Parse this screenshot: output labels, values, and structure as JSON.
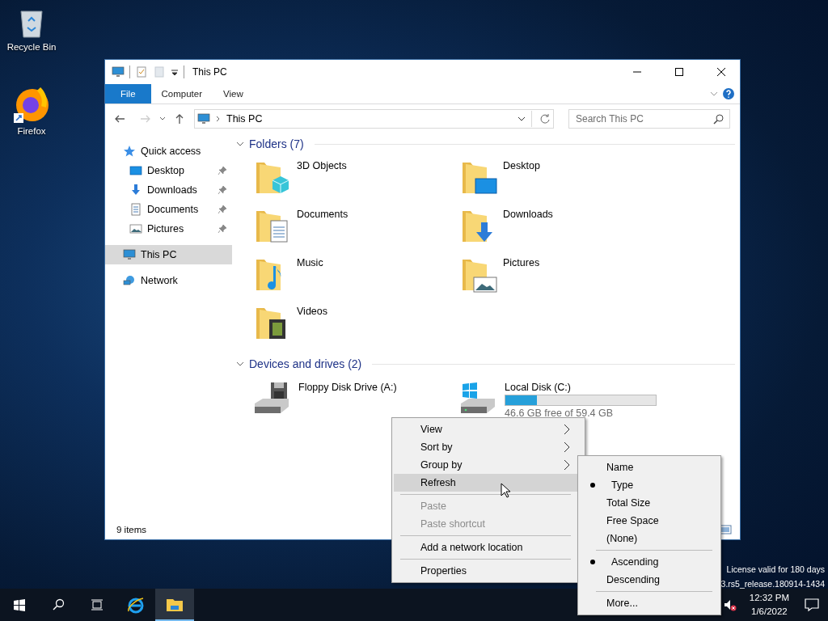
{
  "desktop_icons": [
    {
      "label": "Recycle Bin",
      "kind": "recycle"
    },
    {
      "label": "Firefox",
      "kind": "firefox"
    }
  ],
  "window": {
    "title": "This PC",
    "ribbon_tabs": [
      {
        "label": "File",
        "selected": true
      },
      {
        "label": "Computer",
        "selected": false
      },
      {
        "label": "View",
        "selected": false
      }
    ],
    "address": "This PC",
    "search": {
      "placeholder": "Search This PC"
    },
    "nav": [
      {
        "label": "Quick access",
        "kind": "star",
        "selected": false,
        "children": [
          {
            "label": "Desktop",
            "kind": "desktop",
            "pinned": true
          },
          {
            "label": "Downloads",
            "kind": "downloads",
            "pinned": true
          },
          {
            "label": "Documents",
            "kind": "documents",
            "pinned": true
          },
          {
            "label": "Pictures",
            "kind": "pictures",
            "pinned": true
          }
        ]
      },
      {
        "label": "This PC",
        "kind": "pc",
        "selected": true
      },
      {
        "label": "Network",
        "kind": "network",
        "selected": false
      }
    ],
    "folders": {
      "title": "Folders (7)",
      "expanded": true,
      "items": [
        {
          "name": "3D Objects",
          "kind": "objects"
        },
        {
          "name": "Desktop",
          "kind": "desktop"
        },
        {
          "name": "Documents",
          "kind": "documents"
        },
        {
          "name": "Downloads",
          "kind": "downloads"
        },
        {
          "name": "Music",
          "kind": "music"
        },
        {
          "name": "Pictures",
          "kind": "pictures"
        },
        {
          "name": "Videos",
          "kind": "videos"
        }
      ]
    },
    "drives": {
      "title": "Devices and drives (2)",
      "expanded": true,
      "items": [
        {
          "name": "Floppy Disk Drive (A:)",
          "kind": "floppy"
        },
        {
          "name": "Local Disk (C:)",
          "kind": "disk",
          "level": 0.21,
          "free": "46.6 GB free of 59.4 GB"
        }
      ]
    },
    "status_bar": "9 items"
  },
  "context_menu": {
    "items": [
      {
        "kind": "item",
        "label": "View",
        "submenu": true,
        "disabled": false,
        "selected": false
      },
      {
        "kind": "item",
        "label": "Sort by",
        "submenu": true,
        "disabled": false,
        "selected": false
      },
      {
        "kind": "item",
        "label": "Group by",
        "submenu": true,
        "disabled": false,
        "selected": false
      },
      {
        "kind": "item",
        "label": "Refresh",
        "submenu": false,
        "disabled": false,
        "selected": true
      },
      {
        "kind": "separator"
      },
      {
        "kind": "item",
        "label": "Paste",
        "submenu": false,
        "disabled": true,
        "selected": false
      },
      {
        "kind": "item",
        "label": "Paste shortcut",
        "submenu": false,
        "disabled": true,
        "selected": false
      },
      {
        "kind": "separator"
      },
      {
        "kind": "item",
        "label": "Add a network location",
        "submenu": false,
        "disabled": false,
        "selected": false
      },
      {
        "kind": "separator"
      },
      {
        "kind": "item",
        "label": "Properties",
        "submenu": false,
        "disabled": false,
        "selected": false
      }
    ]
  },
  "submenu": {
    "items": [
      {
        "kind": "radio",
        "label": "Name",
        "checked": false
      },
      {
        "kind": "radio",
        "label": "Type",
        "checked": true
      },
      {
        "kind": "radio",
        "label": "Total Size",
        "checked": false
      },
      {
        "kind": "radio",
        "label": "Free Space",
        "checked": false
      },
      {
        "kind": "radio",
        "label": "(None)",
        "checked": false
      },
      {
        "kind": "separator"
      },
      {
        "kind": "radio",
        "label": "Ascending",
        "checked": true
      },
      {
        "kind": "radio",
        "label": "Descending",
        "checked": false
      },
      {
        "kind": "separator"
      },
      {
        "kind": "radio",
        "label": "More...",
        "checked": false
      }
    ]
  },
  "desktop_notice": [
    "License valid for 180 days",
    "3.rs5_release.180914-1434"
  ],
  "taskbar": {
    "apps": [
      {
        "kind": "ie",
        "selected": false
      },
      {
        "kind": "explorer",
        "selected": true
      }
    ],
    "time": "12:32 PM",
    "date": "1/6/2022"
  }
}
